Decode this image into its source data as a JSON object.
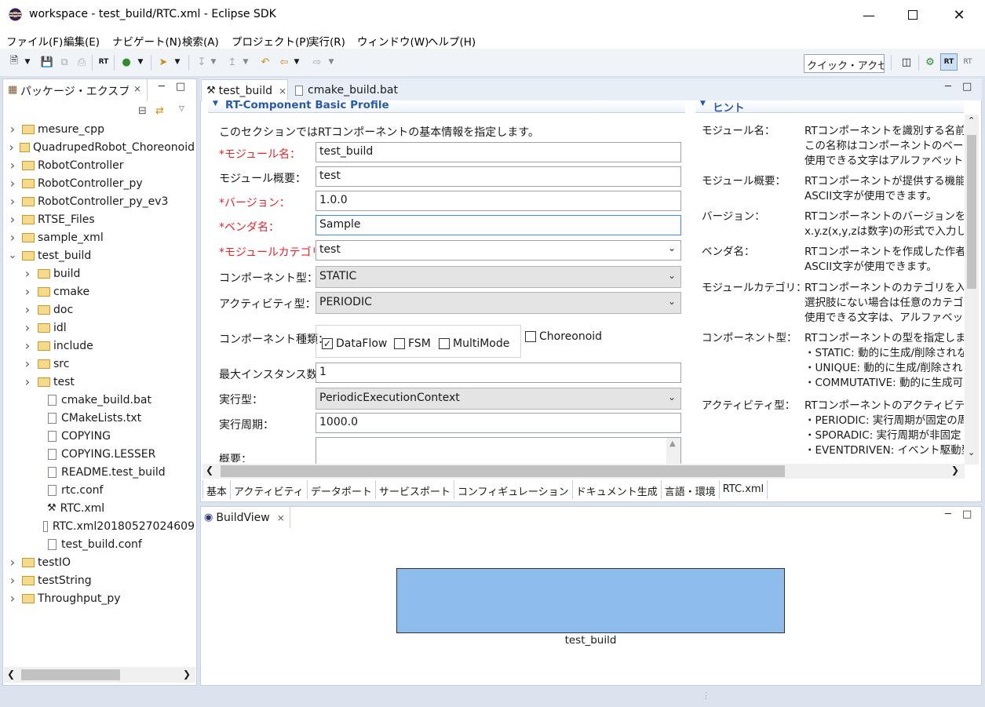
{
  "window": {
    "title": "workspace - test_build/RTC.xml - Eclipse SDK",
    "min_icon": "minimize-icon",
    "max_icon": "maximize-icon",
    "close_icon": "close-icon"
  },
  "menu": [
    "ファイル(F)",
    "編集(E)",
    "ナビゲート(N)",
    "検索(A)",
    "プロジェクト(P)",
    "実行(R)",
    "ウィンドウ(W)",
    "ヘルプ(H)"
  ],
  "toolbar": {
    "quick_access": "クイック・アクセス",
    "rt_label": "RT"
  },
  "explorer": {
    "title": "パッケージ・エクスプローラー",
    "items": [
      {
        "label": "mesure_cpp",
        "level": 0,
        "kind": "project",
        "expanded": false
      },
      {
        "label": "QuadrupedRobot_Choreonoid",
        "level": 0,
        "kind": "project",
        "expanded": false
      },
      {
        "label": "RobotController",
        "level": 0,
        "kind": "project",
        "expanded": false
      },
      {
        "label": "RobotController_py",
        "level": 0,
        "kind": "project",
        "expanded": false
      },
      {
        "label": "RobotController_py_ev3",
        "level": 0,
        "kind": "project",
        "expanded": false
      },
      {
        "label": "RTSE_Files",
        "level": 0,
        "kind": "project",
        "expanded": false
      },
      {
        "label": "sample_xml",
        "level": 0,
        "kind": "project",
        "expanded": false
      },
      {
        "label": "test_build",
        "level": 0,
        "kind": "project",
        "expanded": true
      },
      {
        "label": "build",
        "level": 1,
        "kind": "folder",
        "expanded": false
      },
      {
        "label": "cmake",
        "level": 1,
        "kind": "folder",
        "expanded": false
      },
      {
        "label": "doc",
        "level": 1,
        "kind": "folder",
        "expanded": false
      },
      {
        "label": "idl",
        "level": 1,
        "kind": "folder",
        "expanded": false
      },
      {
        "label": "include",
        "level": 1,
        "kind": "folder",
        "expanded": false
      },
      {
        "label": "src",
        "level": 1,
        "kind": "folder",
        "expanded": false
      },
      {
        "label": "test",
        "level": 1,
        "kind": "folder",
        "expanded": false
      },
      {
        "label": "cmake_build.bat",
        "level": 1,
        "kind": "file"
      },
      {
        "label": "CMakeLists.txt",
        "level": 1,
        "kind": "file"
      },
      {
        "label": "COPYING",
        "level": 1,
        "kind": "file"
      },
      {
        "label": "COPYING.LESSER",
        "level": 1,
        "kind": "file"
      },
      {
        "label": "README.test_build",
        "level": 1,
        "kind": "file"
      },
      {
        "label": "rtc.conf",
        "level": 1,
        "kind": "file"
      },
      {
        "label": "RTC.xml",
        "level": 1,
        "kind": "rtc"
      },
      {
        "label": "RTC.xml20180527024609",
        "level": 1,
        "kind": "file"
      },
      {
        "label": "test_build.conf",
        "level": 1,
        "kind": "file"
      },
      {
        "label": "testIO",
        "level": 0,
        "kind": "project",
        "expanded": false
      },
      {
        "label": "testString",
        "level": 0,
        "kind": "project",
        "expanded": false
      },
      {
        "label": "Throughput_py",
        "level": 0,
        "kind": "project",
        "expanded": false
      }
    ]
  },
  "editor": {
    "tabs": [
      {
        "label": "test_build",
        "active": true
      },
      {
        "label": "cmake_build.bat",
        "active": false
      }
    ],
    "section_title": "RT-Component Basic Profile",
    "section_desc": "このセクションではRTコンポーネントの基本情報を指定します。",
    "hint_title": "ヒント",
    "fields": {
      "module_name": {
        "label": "*モジュール名：",
        "value": "test_build"
      },
      "module_desc": {
        "label": "モジュール概要：",
        "value": "test"
      },
      "version": {
        "label": "*バージョン：",
        "value": "1.0.0"
      },
      "vendor": {
        "label": "*ベンダ名：",
        "value": "Sample"
      },
      "category": {
        "label": "*モジュールカテゴリ：",
        "value": "test"
      },
      "comp_type": {
        "label": "コンポーネント型：",
        "value": "STATIC"
      },
      "activity_type": {
        "label": "アクティビティ型：",
        "value": "PERIODIC"
      },
      "comp_kind": {
        "label": "コンポーネント種類：",
        "options": [
          {
            "label": "DataFlow",
            "checked": true
          },
          {
            "label": "FSM",
            "checked": false
          },
          {
            "label": "MultiMode",
            "checked": false
          }
        ],
        "choreonoid": {
          "label": "Choreonoid",
          "checked": false
        }
      },
      "max_instances": {
        "label": "最大インスタンス数：",
        "value": "1"
      },
      "exec_type": {
        "label": "実行型：",
        "value": "PeriodicExecutionContext"
      },
      "exec_rate": {
        "label": "実行周期：",
        "value": "1000.0"
      },
      "overview": {
        "label": "概要："
      }
    },
    "hints": [
      {
        "key": "モジュール名：",
        "lines": [
          "RTコンポーネントを識別する名前を:",
          "この名称はコンポーネントのベースイン",
          "使用できる文字はアルファベット、数"
        ]
      },
      {
        "key": "モジュール概要：",
        "lines": [
          "RTコンポーネントが提供する機能の",
          "ASCII文字が使用できます。"
        ]
      },
      {
        "key": "バージョン：",
        "lines": [
          "RTコンポーネントのバージョンを指定",
          "x.y.z(x,y,zは数字)の形式で入力し"
        ]
      },
      {
        "key": "ベンダ名：",
        "lines": [
          "RTコンポーネントを作成した作者名",
          "ASCII文字が使用できます。"
        ]
      },
      {
        "key": "モジュールカテゴリ：",
        "lines": [
          "RTコンポーネントのカテゴリを入力し",
          "選択肢にない場合は任意のカテゴ",
          "使用できる文字は、アルファベット、"
        ]
      },
      {
        "key": "コンポーネント型：",
        "lines": [
          "RTコンポーネントの型を指定します。",
          "・STATIC: 動的に生成/削除されな",
          "・UNIQUE: 動的に生成/削除され",
          "・COMMUTATIVE: 動的に生成可"
        ]
      },
      {
        "key": "アクティビティ型：",
        "lines": [
          "RTコンポーネントのアクティビティ型を",
          "・PERIODIC: 実行周期が固定の周",
          "・SPORADIC: 実行周期が非固定",
          "・EVENTDRIVEN: イベント駆動型"
        ]
      }
    ],
    "bottom_tabs": [
      "基本",
      "アクティビティ",
      "データポート",
      "サービスポート",
      "コンフィギュレーション",
      "ドキュメント生成",
      "言語・環境",
      "RTC.xml"
    ],
    "active_bottom_tab": "基本"
  },
  "buildview": {
    "title": "BuildView",
    "component_label": "test_build",
    "component_color": "#8fbdeb"
  }
}
